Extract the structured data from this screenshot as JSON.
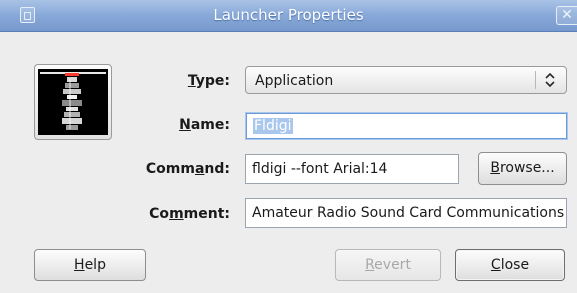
{
  "window": {
    "title": "Launcher Properties",
    "close_glyph": "✕"
  },
  "icon": {
    "name": "fldigi-app-icon"
  },
  "type": {
    "label_u": "T",
    "label_rest": "ype:",
    "value": "Application"
  },
  "name": {
    "label_u": "N",
    "label_rest": "ame:",
    "value": "Fldigi"
  },
  "command": {
    "label_pre": "Comm",
    "label_u": "a",
    "label_rest": "nd:",
    "value": "fldigi --font Arial:14"
  },
  "comment": {
    "label_pre": "Co",
    "label_u": "m",
    "label_rest": "ment:",
    "value": "Amateur Radio Sound Card Communications"
  },
  "buttons": {
    "browse": {
      "u": "B",
      "rest": "rowse..."
    },
    "help": {
      "u": "H",
      "rest": "elp"
    },
    "revert": {
      "u": "R",
      "rest": "evert"
    },
    "close": {
      "u": "C",
      "rest": "lose"
    }
  }
}
